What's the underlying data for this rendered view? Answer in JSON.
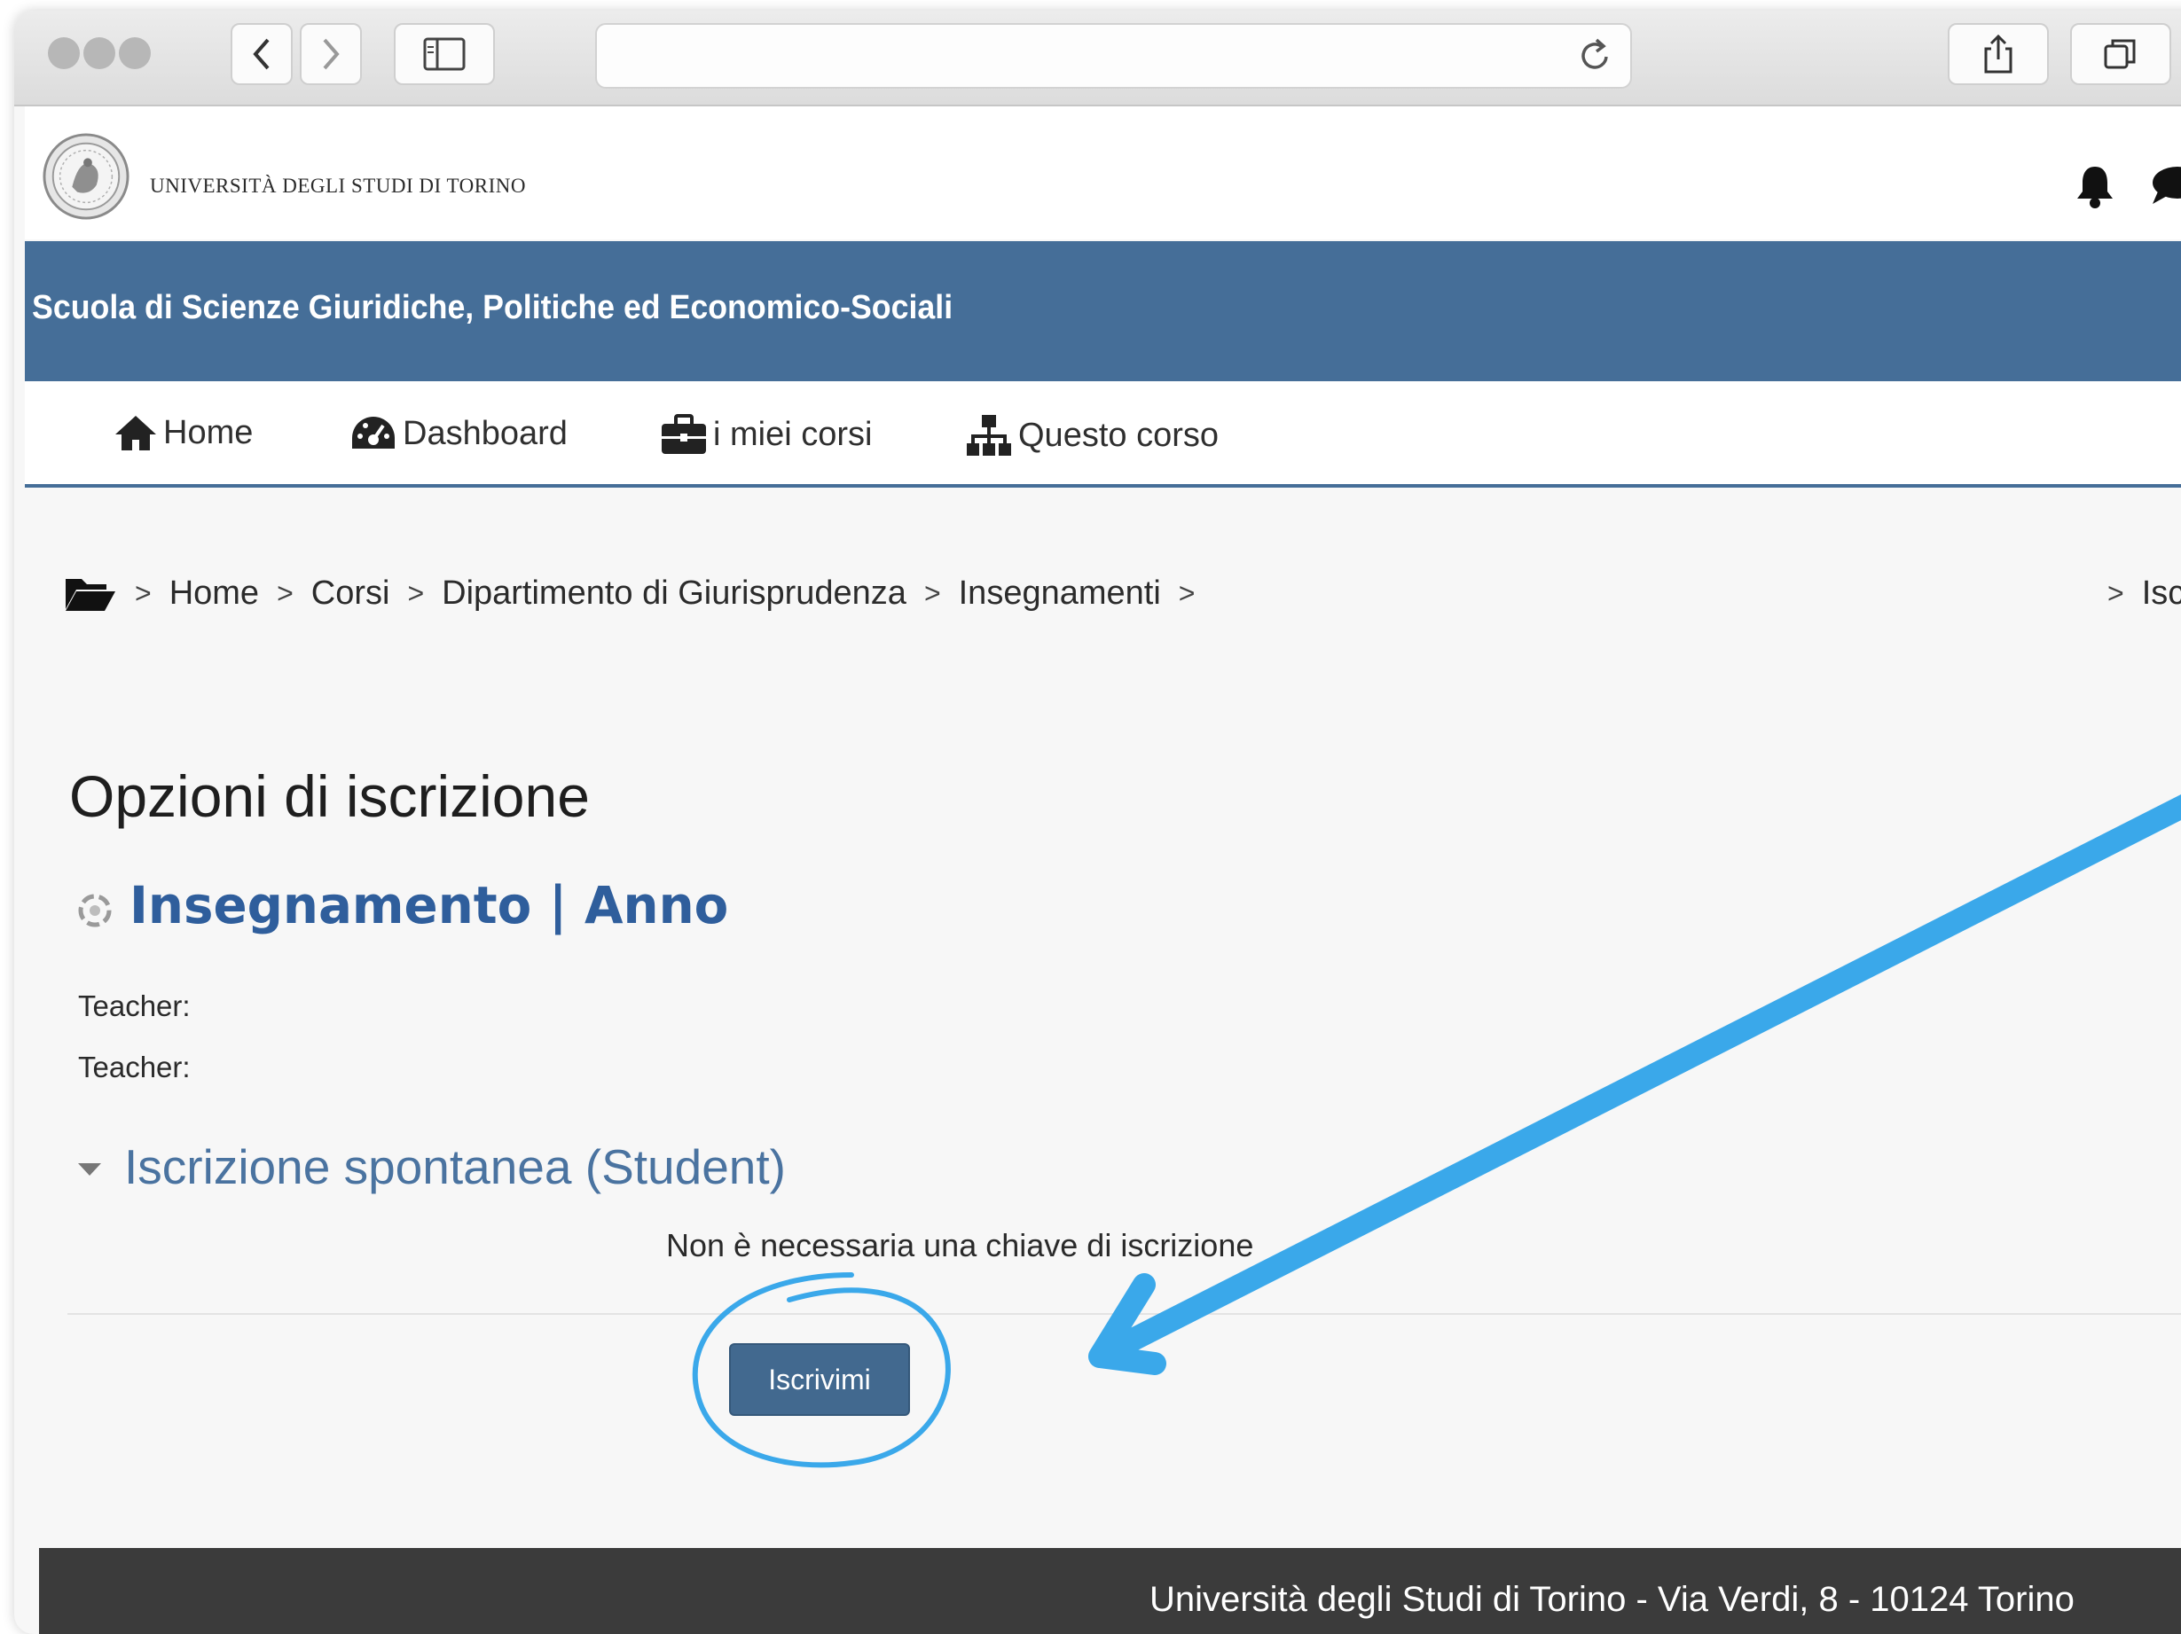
{
  "browser": {
    "icons": [
      "back-icon",
      "forward-icon",
      "sidebar-icon",
      "reload-icon",
      "share-icon",
      "tabs-icon"
    ]
  },
  "header": {
    "university_name": "UNIVERSITÀ DEGLI STUDI DI TORINO",
    "school_name": "Scuola di Scienze Giuridiche, Politiche ed Economico-Sociali"
  },
  "nav": {
    "items": [
      {
        "label": "Home",
        "icon": "home-icon"
      },
      {
        "label": "Dashboard",
        "icon": "dashboard-icon"
      },
      {
        "label": "i miei corsi",
        "icon": "briefcase-icon"
      },
      {
        "label": "Questo corso",
        "icon": "sitemap-icon"
      }
    ]
  },
  "breadcrumb": {
    "items": [
      "Home",
      "Corsi",
      "Dipartimento di Giurisprudenza",
      "Insegnamenti"
    ],
    "trailing": "Isc"
  },
  "main": {
    "page_title": "Opzioni di iscrizione",
    "course_title": "Insegnamento | Anno",
    "teachers": [
      "Teacher:",
      "Teacher:"
    ],
    "section_heading": "Iscrizione spontanea (Student)",
    "notice": "Non è necessaria una chiave di iscrizione",
    "enrol_button": "Iscrivimi"
  },
  "annotation": {
    "color": "#3aa8ea"
  },
  "footer": {
    "text": "Università degli Studi di Torino - Via Verdi, 8 - 10124 Torino"
  },
  "colors": {
    "banner": "#456e98",
    "course_title": "#2f5e9c",
    "section_heading": "#4a73a0",
    "button": "#42698f",
    "footer": "#3b3b3b"
  }
}
